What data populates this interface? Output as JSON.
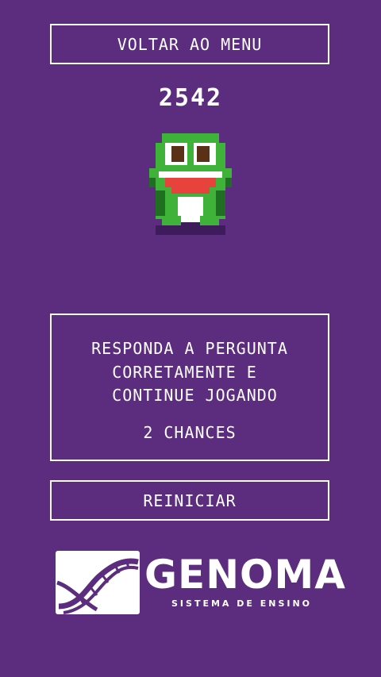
{
  "header": {
    "menu_label": "VOLTAR AO MENU"
  },
  "score": "2542",
  "player": {
    "icon": "frog-icon"
  },
  "message": {
    "line1": "RESPONDA A PERGUNTA",
    "line2": "CORRETAMENTE E ",
    "line3": " CONTINUE JOGANDO",
    "chances": "2 CHANCES"
  },
  "restart_label": "REINICIAR",
  "logo": {
    "name": "GENOMA",
    "tagline": "SISTEMA DE ENSINO"
  },
  "colors": {
    "background": "#5c2d7e",
    "frog_green": "#3fb23a",
    "frog_dark": "#1f6e22"
  }
}
